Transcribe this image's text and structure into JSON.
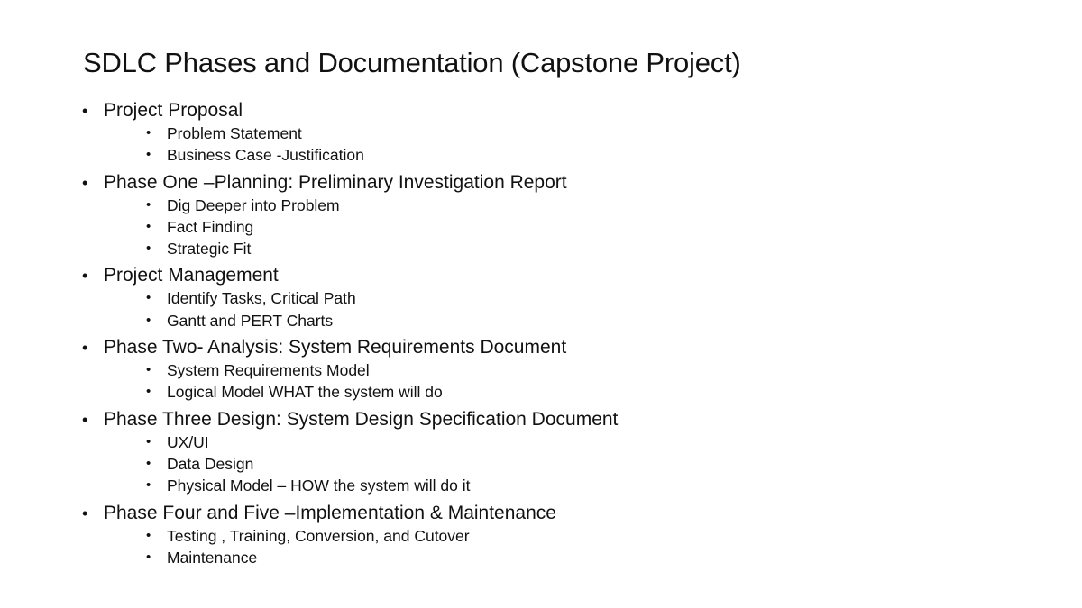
{
  "slide": {
    "title": "SDLC Phases and Documentation  (Capstone Project)",
    "bullet_glyph": "•",
    "sections": [
      {
        "label": "Project Proposal",
        "items": [
          "Problem Statement",
          "Business Case -Justification"
        ]
      },
      {
        "label": "Phase One –Planning: Preliminary Investigation Report",
        "items": [
          "Dig Deeper into Problem",
          "Fact Finding",
          "Strategic Fit"
        ]
      },
      {
        "label": "Project Management",
        "items": [
          "Identify Tasks, Critical Path",
          "Gantt and PERT Charts"
        ]
      },
      {
        "label": "Phase Two- Analysis: System Requirements Document",
        "items": [
          "System Requirements Model",
          "Logical Model WHAT the system will do"
        ]
      },
      {
        "label": "Phase Three Design: System Design Specification Document",
        "items": [
          "UX/UI",
          "Data Design",
          "Physical Model – HOW the system will do it"
        ]
      },
      {
        "label": "Phase Four and Five –Implementation & Maintenance",
        "items": [
          "Testing , Training, Conversion, and Cutover",
          "Maintenance"
        ]
      }
    ]
  }
}
